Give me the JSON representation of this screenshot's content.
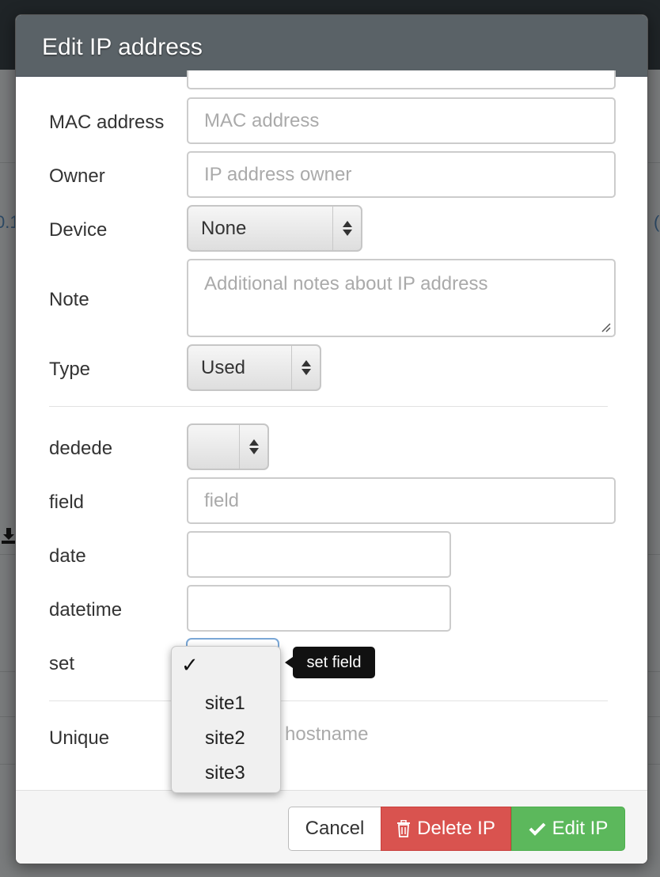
{
  "dialog": {
    "title": "Edit IP address",
    "fields": {
      "mac": {
        "label": "MAC address",
        "placeholder": "MAC address"
      },
      "owner": {
        "label": "Owner",
        "placeholder": "IP address owner"
      },
      "device": {
        "label": "Device",
        "value": "None"
      },
      "note": {
        "label": "Note",
        "placeholder": "Additional notes about IP address"
      },
      "type": {
        "label": "Type",
        "value": "Used"
      },
      "dedede": {
        "label": "dedede",
        "value": ""
      },
      "field": {
        "label": "field",
        "placeholder": "field"
      },
      "date": {
        "label": "date",
        "value": ""
      },
      "datetime": {
        "label": "datetime",
        "value": ""
      },
      "set": {
        "label": "set",
        "tooltip": "set field"
      },
      "unique": {
        "label": "Unique",
        "partial_text": "e hostname"
      }
    },
    "set_dropdown": {
      "checkmark": "✓",
      "options": [
        "site1",
        "site2",
        "site3"
      ]
    },
    "buttons": {
      "cancel": "Cancel",
      "delete": "Delete IP",
      "edit": "Edit IP"
    }
  },
  "background": {
    "fragment_left": "0.1",
    "fragment_right": "("
  },
  "colors": {
    "header": "#5a6267",
    "danger": "#d9534f",
    "success": "#5cb85c"
  }
}
